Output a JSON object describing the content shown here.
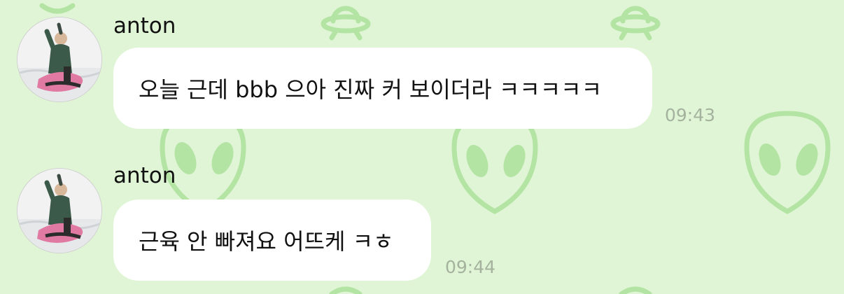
{
  "messages": [
    {
      "sender": "anton",
      "text": "오늘 근데 bbb 으아 진짜 커 보이더라 ㅋㅋㅋㅋㅋ",
      "time": "09:43"
    },
    {
      "sender": "anton",
      "text": "근육 안 빠져요 어뜨케 ㅋㅎ",
      "time": "09:44"
    }
  ],
  "colors": {
    "background": "#dff5d5",
    "pattern": "#b3e4a3",
    "bubble": "#ffffff",
    "timestamp": "#a4b29e"
  },
  "icons": [
    "ufo-icon",
    "alien-face-icon",
    "avatar-photo"
  ]
}
